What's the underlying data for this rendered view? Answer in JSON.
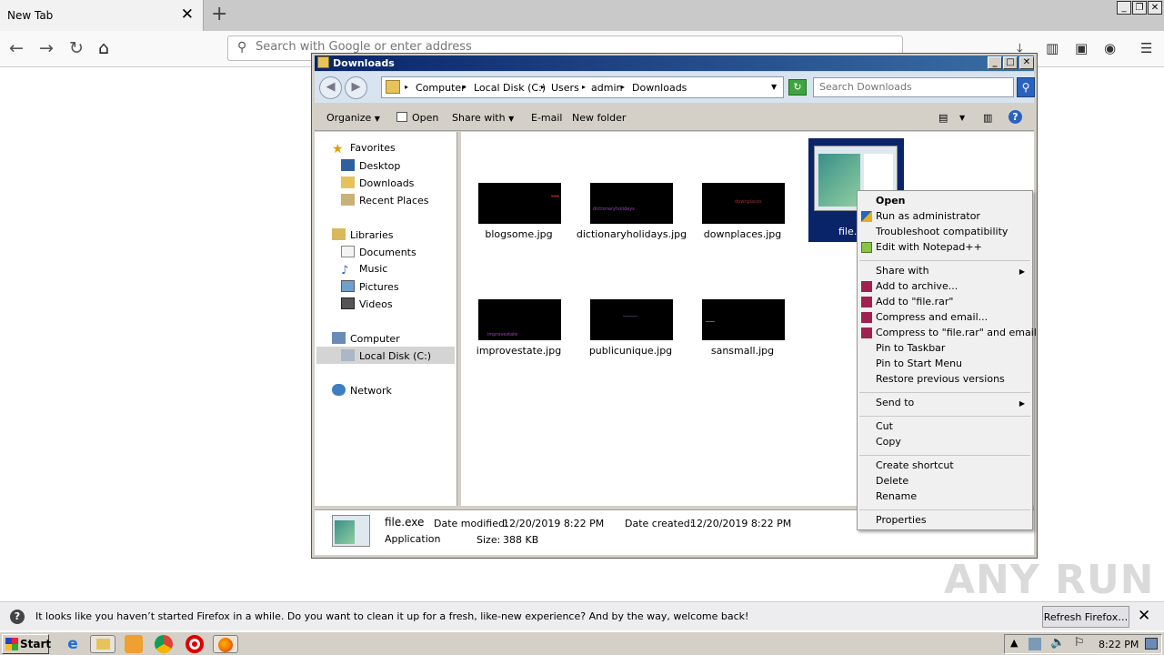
{
  "browser": {
    "tab_title": "New Tab",
    "url_placeholder": "Search with Google or enter address"
  },
  "explorer": {
    "title": "Downloads",
    "breadcrumb": [
      "Computer",
      "Local Disk (C:)",
      "Users",
      "admin",
      "Downloads"
    ],
    "search_placeholder": "Search Downloads",
    "toolbar": {
      "organize": "Organize",
      "open": "Open",
      "share_with": "Share with",
      "email": "E-mail",
      "new_folder": "New folder"
    },
    "nav": {
      "favorites": "Favorites",
      "desktop": "Desktop",
      "downloads": "Downloads",
      "recent_places": "Recent Places",
      "libraries": "Libraries",
      "documents": "Documents",
      "music": "Music",
      "pictures": "Pictures",
      "videos": "Videos",
      "computer": "Computer",
      "local_disk": "Local Disk (C:)",
      "network": "Network"
    },
    "files": [
      {
        "name": "blogsome.jpg",
        "thumb_text": ""
      },
      {
        "name": "dictionaryholidays.jpg",
        "thumb_text": "dictionaryholidays"
      },
      {
        "name": "downplaces.jpg",
        "thumb_text": "downplaces"
      },
      {
        "name": "file.exe",
        "short": "file."
      },
      {
        "name": "improvestate.jpg",
        "thumb_text": "improvestate"
      },
      {
        "name": "publicunique.jpg",
        "thumb_text": ""
      },
      {
        "name": "sansmall.jpg",
        "thumb_text": ""
      }
    ],
    "status": {
      "file_name": "file.exe",
      "file_type": "Application",
      "date_modified_label": "Date modified:",
      "date_modified": "12/20/2019 8:22 PM",
      "date_created_label": "Date created:",
      "date_created": "12/20/2019 8:22 PM",
      "size_label": "Size:",
      "size": "388 KB"
    }
  },
  "context_menu": {
    "open": "Open",
    "run_as_admin": "Run as administrator",
    "troubleshoot": "Troubleshoot compatibility",
    "edit_notepad": "Edit with Notepad++",
    "share_with": "Share with",
    "add_archive": "Add to archive...",
    "add_rar": "Add to \"file.rar\"",
    "compress_email": "Compress and email...",
    "compress_rar_email": "Compress to \"file.rar\" and email",
    "pin_taskbar": "Pin to Taskbar",
    "pin_start": "Pin to Start Menu",
    "restore": "Restore previous versions",
    "send_to": "Send to",
    "cut": "Cut",
    "copy": "Copy",
    "create_shortcut": "Create shortcut",
    "delete": "Delete",
    "rename": "Rename",
    "properties": "Properties"
  },
  "notification": {
    "message": "It looks like you haven’t started Firefox in a while. Do you want to clean it up for a fresh, like-new experience? And by the way, welcome back!",
    "button": "Refresh Firefox…"
  },
  "taskbar": {
    "start": "Start",
    "clock": "8:22 PM"
  },
  "watermark": "ANY RUN"
}
